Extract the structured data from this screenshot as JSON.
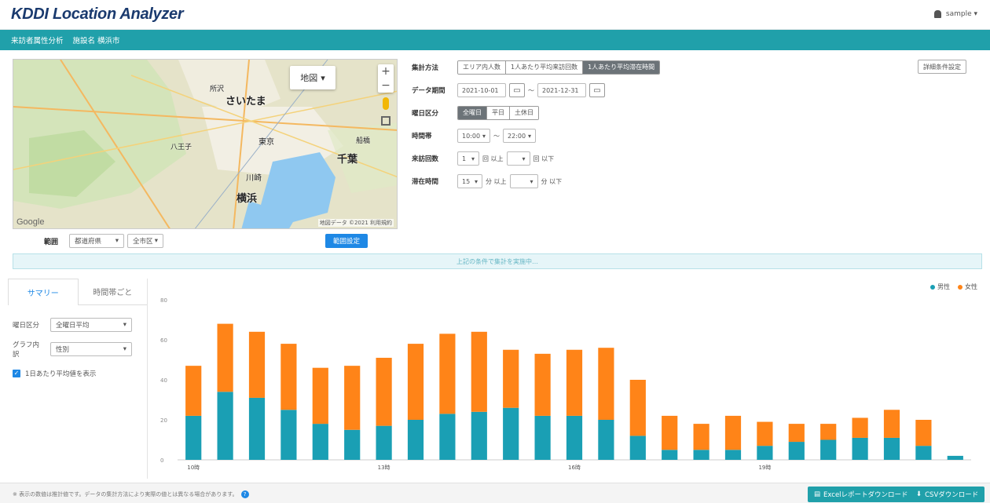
{
  "header": {
    "logo": "KDDI Location Analyzer",
    "user": "sample ▾"
  },
  "nav": {
    "item1": "来訪者属性分析",
    "item2": "施設名 横浜市"
  },
  "map": {
    "type_label": "地図",
    "labels": [
      "さいたま",
      "東京",
      "千葉",
      "川崎",
      "横浜",
      "八王子",
      "所沢",
      "船橋"
    ],
    "google": "Google",
    "attribution": "地図データ ©2021 利用規約"
  },
  "under_map": {
    "label": "範囲",
    "select1": "都道府県",
    "select2": "全市区",
    "button": "範囲設定"
  },
  "detail_button": "詳細条件設定",
  "form": {
    "agg_label": "集計方法",
    "agg_options": [
      "エリア内人数",
      "1人あたり平均来訪回数",
      "1人あたり平均滞在時間"
    ],
    "period_label": "データ期間",
    "period_from": "2021-10-01",
    "period_to": "2021-12-31",
    "day_label": "曜日区分",
    "day_options": [
      "全曜日",
      "平日",
      "土休日"
    ],
    "time_label": "時間帯",
    "time_from": "10:00",
    "time_to": "22:00",
    "visits_label": "来訪回数",
    "visits_from": "1",
    "visits_mid": "回 以上",
    "visits_end": "回 以下",
    "stay_label": "滞在時間",
    "stay_from": "15",
    "stay_mid": "分 以上",
    "stay_end": "分 以下"
  },
  "info_bar": "上記の条件で集計を実施中…",
  "sidebar": {
    "tab_summary": "サマリー",
    "tab_time": "時間帯ごと",
    "row1_label": "曜日区分",
    "row1_value": "全曜日平均",
    "row2_label": "グラフ内訳",
    "row2_value": "性別",
    "check_label": "1日あたり平均値を表示"
  },
  "footer": {
    "note": "※ 表示の数値は推計値です。データの集計方法により実際の値とは異なる場合があります。",
    "excel_button": "Excelレポートダウンロード",
    "csv_button": "CSVダウンロード"
  },
  "colors": {
    "teal": "#20a0aa",
    "orange": "#ff8418",
    "male": "#1a9fb4"
  },
  "chart_data": {
    "type": "bar",
    "stacked": true,
    "categories": [
      "10時",
      "",
      "",
      "",
      "",
      "",
      "",
      "",
      "",
      "",
      "",
      "",
      "",
      "",
      "",
      "",
      "",
      "",
      "",
      "",
      "",
      "",
      "",
      "",
      "",
      ""
    ],
    "x_tick_labels": [
      {
        "index": 0,
        "text": "10時"
      },
      {
        "index": 6,
        "text": "13時"
      },
      {
        "index": 12,
        "text": "16時"
      },
      {
        "index": 18,
        "text": "19時"
      }
    ],
    "series": [
      {
        "name": "男性",
        "color": "#1a9fb4",
        "values": [
          22,
          34,
          31,
          25,
          18,
          15,
          17,
          20,
          23,
          24,
          26,
          22,
          22,
          20,
          12,
          5,
          5,
          5,
          7,
          9,
          10,
          11,
          11,
          7,
          2
        ]
      },
      {
        "name": "女性",
        "color": "#ff8418",
        "values": [
          25,
          34,
          33,
          33,
          28,
          32,
          34,
          38,
          40,
          40,
          29,
          31,
          33,
          36,
          28,
          17,
          13,
          17,
          12,
          9,
          8,
          10,
          14,
          13,
          0
        ]
      }
    ],
    "y_tick_labels": [
      "80",
      "60",
      "40",
      "20",
      "0"
    ],
    "ylim": [
      0,
      80
    ],
    "legend": "top-right",
    "grid": false
  }
}
